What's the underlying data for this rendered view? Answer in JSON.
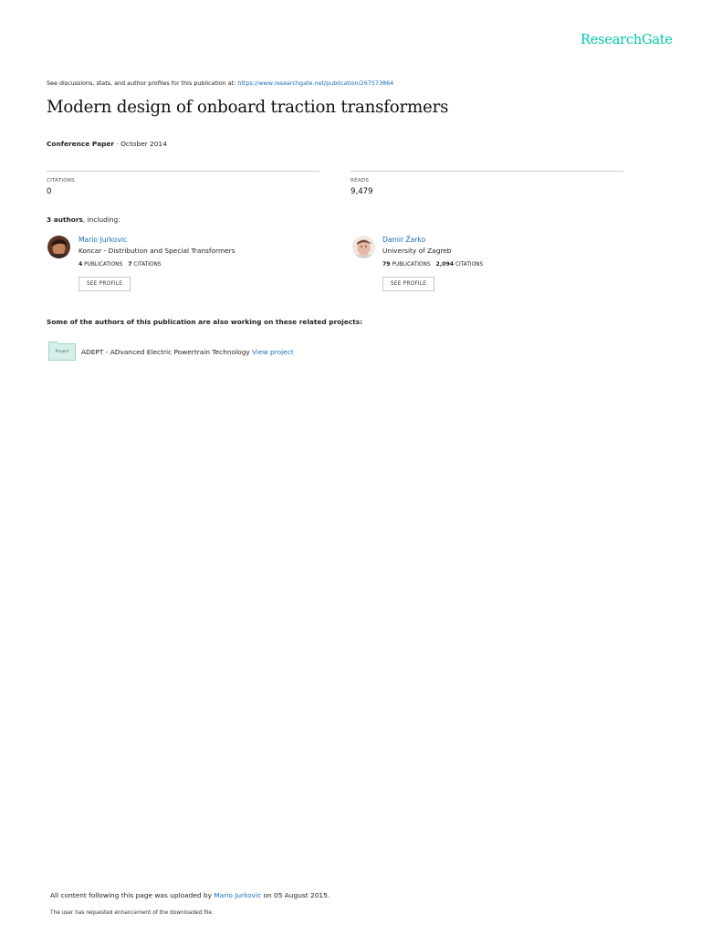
{
  "brand": {
    "logo_text": "ResearchGate",
    "accent_color": "#00c7a9",
    "link_color": "#1a6db5"
  },
  "header": {
    "discuss_prefix": "See discussions, stats, and author profiles for this publication at: ",
    "discuss_url": "https://www.researchgate.net/publication/267573864"
  },
  "publication": {
    "title": "Modern design of onboard traction transformers",
    "type": "Conference Paper",
    "date_sep": " · ",
    "date": "October 2014"
  },
  "stats": {
    "citations_label": "CITATIONS",
    "citations_value": "0",
    "reads_label": "READS",
    "reads_value": "9,479"
  },
  "authors_section": {
    "count_text": "3 authors",
    "suffix": ", including:"
  },
  "authors": [
    {
      "name": "Mario Jurkovic",
      "affiliation": "Koncar - Distribution and Special Transformers",
      "publications_count": "4",
      "publications_label": "PUBLICATIONS",
      "citations_count": "7",
      "citations_label": "CITATIONS",
      "button_label": "SEE PROFILE"
    },
    {
      "name": "Damir Žarko",
      "affiliation": "University of Zagreb",
      "publications_count": "79",
      "publications_label": "PUBLICATIONS",
      "citations_count": "2,094",
      "citations_label": "CITATIONS",
      "button_label": "SEE PROFILE"
    }
  ],
  "related": {
    "heading": "Some of the authors of this publication are also working on these related projects:",
    "projects": [
      {
        "thumb_label": "Project",
        "name": "ADEPT - ADvanced Electric Powertrain Technology",
        "link_label": "View project"
      }
    ]
  },
  "footer": {
    "upload_prefix": "All content following this page was uploaded by ",
    "uploader": "Mario Jurkovic",
    "upload_suffix": " on 05 August 2015.",
    "note": "The user has requested enhancement of the downloaded file."
  }
}
